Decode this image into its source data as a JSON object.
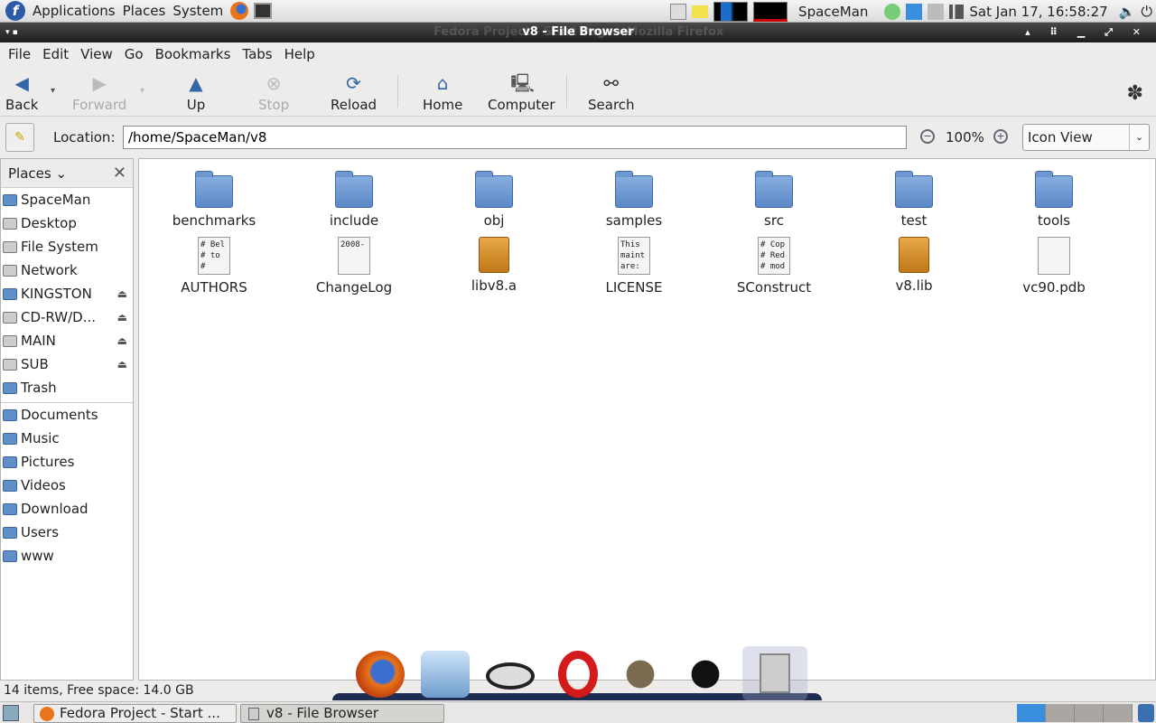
{
  "top_panel": {
    "menus": [
      "Applications",
      "Places",
      "System"
    ],
    "user": "SpaceMan",
    "clock": "Sat Jan 17, 16:58:27"
  },
  "window": {
    "title": "v8 - File Browser",
    "background_title": "Fedora Project - Start Page - Mozilla Firefox"
  },
  "menubar": [
    "File",
    "Edit",
    "View",
    "Go",
    "Bookmarks",
    "Tabs",
    "Help"
  ],
  "toolbar": {
    "back": "Back",
    "forward": "Forward",
    "up": "Up",
    "stop": "Stop",
    "reload": "Reload",
    "home": "Home",
    "computer": "Computer",
    "search": "Search"
  },
  "location": {
    "label": "Location:",
    "value": "/home/SpaceMan/v8",
    "zoom": "100%",
    "view": "Icon View"
  },
  "sidebar": {
    "title": "Places",
    "devices": [
      {
        "label": "SpaceMan",
        "icon": "home-icon"
      },
      {
        "label": "Desktop",
        "icon": "desktop-icon"
      },
      {
        "label": "File System",
        "icon": "drive-icon"
      },
      {
        "label": "Network",
        "icon": "network-icon"
      },
      {
        "label": "KINGSTON",
        "icon": "usb-icon",
        "eject": true
      },
      {
        "label": "CD-RW/D...",
        "icon": "cdrom-icon",
        "eject": true
      },
      {
        "label": "MAIN",
        "icon": "drive-icon",
        "eject": true
      },
      {
        "label": "SUB",
        "icon": "drive-icon",
        "eject": true
      },
      {
        "label": "Trash",
        "icon": "trash-icon"
      }
    ],
    "bookmarks": [
      "Documents",
      "Music",
      "Pictures",
      "Videos",
      "Download",
      "Users",
      "www"
    ]
  },
  "files": [
    {
      "name": "benchmarks",
      "type": "folder"
    },
    {
      "name": "include",
      "type": "folder"
    },
    {
      "name": "obj",
      "type": "folder"
    },
    {
      "name": "samples",
      "type": "folder"
    },
    {
      "name": "src",
      "type": "folder"
    },
    {
      "name": "test",
      "type": "folder"
    },
    {
      "name": "tools",
      "type": "folder"
    },
    {
      "name": "AUTHORS",
      "type": "text",
      "preview": "# Bel\n# to\n#"
    },
    {
      "name": "ChangeLog",
      "type": "text",
      "preview": "2008-"
    },
    {
      "name": "libv8.a",
      "type": "package"
    },
    {
      "name": "LICENSE",
      "type": "text",
      "preview": "This\nmaint\nare:"
    },
    {
      "name": "SConstruct",
      "type": "text",
      "preview": "# Cop\n# Red\n# mod"
    },
    {
      "name": "v8.lib",
      "type": "package"
    },
    {
      "name": "vc90.pdb",
      "type": "text",
      "preview": ""
    }
  ],
  "status": "14 items, Free space: 14.0 GB",
  "taskbar": {
    "tasks": [
      "Fedora Project - Start ...",
      "v8 - File Browser"
    ]
  }
}
